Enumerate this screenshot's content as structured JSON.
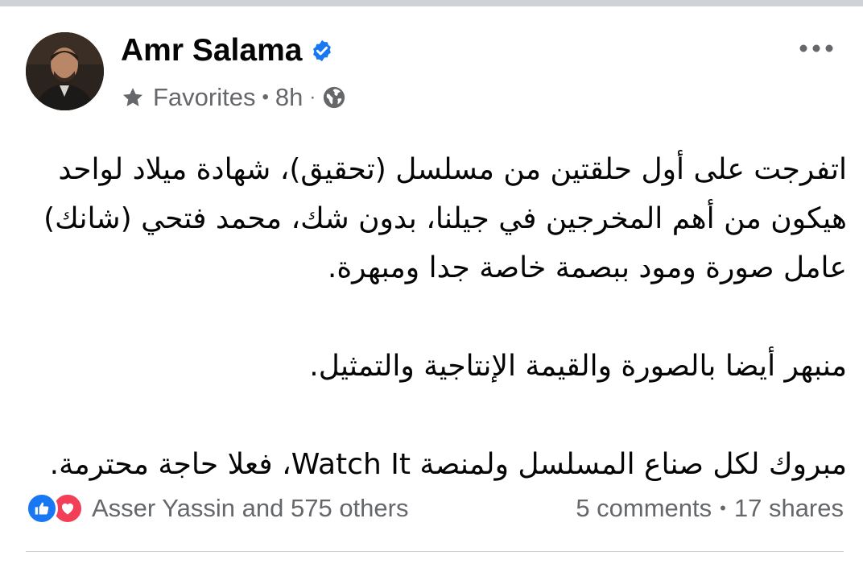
{
  "post": {
    "author_name": "Amr Salama",
    "audience": "Favorites",
    "time": "8h",
    "body_paragraphs": [
      [
        "اتفرجت على أول حلقتين من مسلسل (تحقيق)، شهادة ميلاد لواحد",
        "هيكون من أهم المخرجين في جيلنا، بدون شك، محمد فتحي (شانك)",
        "عامل صورة ومود ببصمة خاصة جدا ومبهرة."
      ],
      [
        "منبهر أيضا بالصورة والقيمة الإنتاجية والتمثيل."
      ],
      [
        "مبروك لكل صناع المسلسل ولمنصة Watch It، فعلا حاجة محترمة."
      ]
    ]
  },
  "footer": {
    "reactions_text": "Asser Yassin and 575 others",
    "comments": "5 comments",
    "shares": "17 shares",
    "separator": "•"
  },
  "meta_separator_1": "•",
  "meta_separator_2": "·",
  "icons": {
    "verified": "verified-badge-icon",
    "more": "more-horizontal-icon",
    "star": "star-icon",
    "globe": "globe-icon",
    "like": "like-reaction-icon",
    "love": "love-reaction-icon"
  },
  "colors": {
    "primary_text": "#050505",
    "secondary_text": "#65676b",
    "like_blue": "#1877f2",
    "love_red": "#f33e58",
    "top_bar": "#cfd2d6"
  }
}
